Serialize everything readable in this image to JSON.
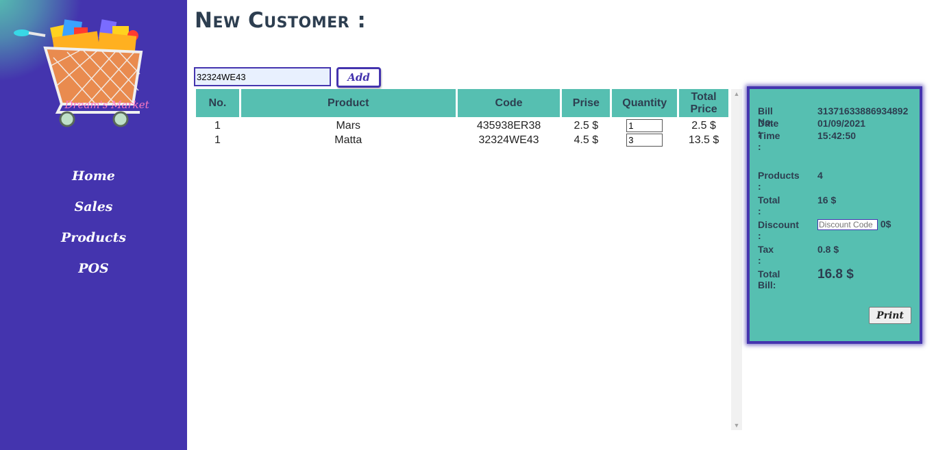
{
  "sidebar": {
    "logo_text": "Dream's Market",
    "nav": [
      {
        "label": "Home"
      },
      {
        "label": "Sales"
      },
      {
        "label": "Products"
      },
      {
        "label": "POS"
      }
    ]
  },
  "main": {
    "title": "New Customer :",
    "code_input_value": "32324WE43",
    "add_label": "Add"
  },
  "table": {
    "headers": [
      "No.",
      "Product",
      "Code",
      "Prise",
      "Quantity",
      "Total Price"
    ],
    "rows": [
      {
        "no": "1",
        "product": "Mars",
        "code": "435938ER38",
        "prise": "2.5 $",
        "quantity": "1",
        "total": "2.5 $"
      },
      {
        "no": "1",
        "product": "Matta",
        "code": "32324WE43",
        "prise": "4.5 $",
        "quantity": "3",
        "total": "13.5 $"
      }
    ]
  },
  "bill": {
    "bill_no_label": "Bill No. :",
    "bill_no": "31371633886934892",
    "date_label": "Date :",
    "date": "01/09/2021",
    "time_label": "Time :",
    "time": "15:42:50",
    "products_label": "Products :",
    "products": "4",
    "total_label": "Total :",
    "total": "16 $",
    "discount_label": "Discount :",
    "discount_placeholder": "Discount Code",
    "discount_value": "0$",
    "tax_label": "Tax :",
    "tax": "0.8 $",
    "total_bill_label": "Total Bill:",
    "total_bill": "16.8 $",
    "print_label": "Print"
  },
  "colors": {
    "sidebar": "#4434ae",
    "accent": "#56bfb1",
    "title": "#2d3e50"
  }
}
